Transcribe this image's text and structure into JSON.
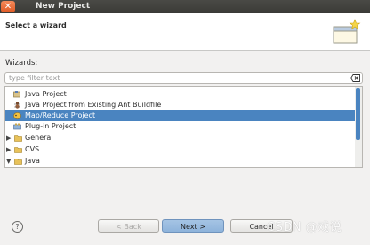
{
  "window": {
    "title": "New Project",
    "close_glyph": "✕"
  },
  "header": {
    "title": "Select a wizard"
  },
  "wizards_label": "Wizards:",
  "filter": {
    "placeholder": "type filter text",
    "value": ""
  },
  "tree": {
    "items": [
      {
        "label": "Java Project",
        "icon": "java-project-icon",
        "arrow": ""
      },
      {
        "label": "Java Project from Existing Ant Buildfile",
        "icon": "ant-buildfile-icon",
        "arrow": ""
      },
      {
        "label": "Map/Reduce Project",
        "icon": "mapreduce-project-icon",
        "arrow": "",
        "selected": true
      },
      {
        "label": "Plug-in Project",
        "icon": "plugin-project-icon",
        "arrow": ""
      },
      {
        "label": "General",
        "icon": "folder-icon",
        "arrow": "▶"
      },
      {
        "label": "CVS",
        "icon": "folder-icon",
        "arrow": "▶"
      },
      {
        "label": "Java",
        "icon": "folder-icon",
        "arrow": "▼"
      }
    ]
  },
  "buttons": {
    "help": "?",
    "back": "< Back",
    "next": "Next >",
    "cancel": "Cancel"
  },
  "watermark": "CSDN @戏说",
  "colors": {
    "selection": "#4a84c0",
    "titlebar": "#3e3e3b",
    "close": "#e8622c"
  }
}
